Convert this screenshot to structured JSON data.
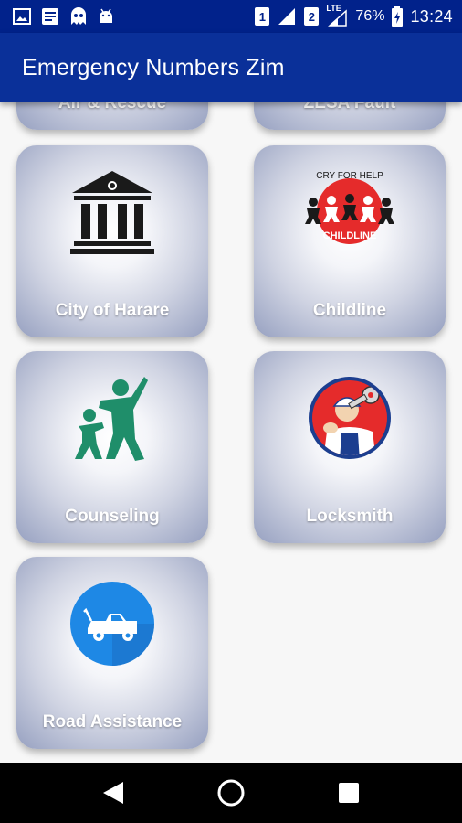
{
  "status_bar": {
    "sim1": "1",
    "sim2": "2",
    "network_type": "LTE",
    "battery": "76%",
    "time": "13:24"
  },
  "app_bar": {
    "title": "Emergency Numbers Zim"
  },
  "tiles": [
    {
      "label": "Air & Rescue",
      "icon": "helicopter-icon"
    },
    {
      "label": "ZESA Fault",
      "icon": "power-icon"
    },
    {
      "label": "City of Harare",
      "icon": "city-hall-icon"
    },
    {
      "label": "Childline",
      "icon": "childline-logo",
      "logo_text_top": "CRY FOR HELP",
      "logo_text_bottom": "CHILDLINE"
    },
    {
      "label": "Counseling",
      "icon": "family-icon"
    },
    {
      "label": "Locksmith",
      "icon": "locksmith-icon"
    },
    {
      "label": "Road Assistance",
      "icon": "tow-truck-icon"
    }
  ],
  "colors": {
    "status_bar": "#01228b",
    "app_bar": "#0a3099",
    "tile_edge": "#96a0c0",
    "counseling_green": "#1f8e6a",
    "childline_red": "#e52b2b",
    "locksmith_blue": "#1c3e8f",
    "tow_blue": "#1e88e5"
  }
}
